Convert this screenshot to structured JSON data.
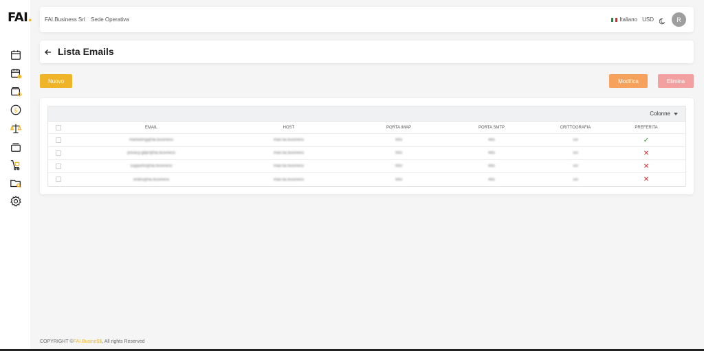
{
  "logo": {
    "text": "FAI",
    "dot": "."
  },
  "header": {
    "company": "FAI.Business Srl",
    "site": "Sede Operativa",
    "language": "Italiano",
    "currency": "USD",
    "avatar_initial": "R",
    "icons": [
      "italy-flag-icon",
      "moon-icon"
    ]
  },
  "page": {
    "title": "Lista Emails",
    "back_icon": "arrow-left-icon"
  },
  "actions": {
    "new": "Nuovo",
    "edit": "Modifica",
    "delete": "Elimina"
  },
  "table": {
    "columns_button": "Colonne",
    "headers": [
      "EMAIL",
      "HOST",
      "PORTA IMAP",
      "PORTA SMTP",
      "CRITTOGRAFIA",
      "PREFERITA"
    ],
    "rows": [
      {
        "email": "marketing@fai.business",
        "host": "mail.fai.business",
        "imap": "993",
        "smtp": "465",
        "crypt": "ssl",
        "preferred": "✓"
      },
      {
        "email": "privacy.gdpr@fai.business",
        "host": "mail.fai.business",
        "imap": "993",
        "smtp": "465",
        "crypt": "ssl",
        "preferred": "✕"
      },
      {
        "email": "supporto@fai.business",
        "host": "mail.fai.business",
        "imap": "993",
        "smtp": "465",
        "crypt": "ssl",
        "preferred": "✕"
      },
      {
        "email": "ordini@fai.business",
        "host": "mail.fai.business",
        "imap": "993",
        "smtp": "465",
        "crypt": "ssl",
        "preferred": "✕"
      }
    ]
  },
  "sidebar": {
    "icons": [
      "calendar-icon",
      "calendar-user-icon",
      "wallet-icon",
      "dollar-icon",
      "scale-icon",
      "cards-icon",
      "cart-icon",
      "folder-search-icon",
      "gear-icon"
    ]
  },
  "footer": {
    "prefix": "COPYRIGHT ©",
    "brand": "FAI.Busine$$",
    "suffix": ", All rights Reserved"
  },
  "colors": {
    "accent": "#f0b429",
    "edit": "#f7a25c",
    "delete": "#f2a0a0",
    "ok": "#2e9a2e",
    "ko": "#e02b2b"
  }
}
